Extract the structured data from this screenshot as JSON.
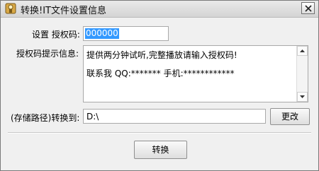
{
  "window": {
    "title": "转换!IT文件设置信息",
    "icons": {
      "app": "app-icon",
      "close": "close-icon"
    }
  },
  "form": {
    "auth_code": {
      "label": "设置 授权码:",
      "value": "000000"
    },
    "hint": {
      "label": "授权码提示信息:",
      "lines": [
        "提供两分钟试听,完整播放请输入授权码!",
        "联系我  QQ:*******  手机:************"
      ]
    },
    "path": {
      "label": "(存储路径)转换到:",
      "value": "D:\\",
      "change_label": "更改"
    },
    "convert_label": "转换"
  }
}
